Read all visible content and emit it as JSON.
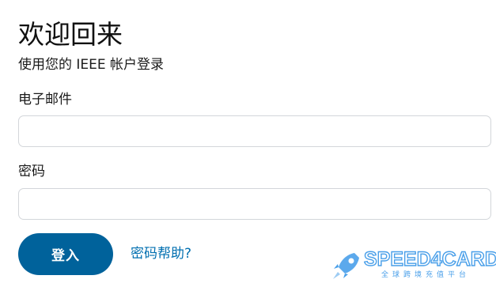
{
  "header": {
    "title": "欢迎回来",
    "subtitle": "使用您的 IEEE 帐户登录"
  },
  "form": {
    "email_label": "电子邮件",
    "email_value": "",
    "email_placeholder": "",
    "password_label": "密码",
    "password_value": "",
    "password_placeholder": "",
    "login_button": "登入",
    "help_link": "密码帮助?"
  },
  "watermark": {
    "brand": "SPEED4CARD",
    "tagline": "全球跨境充值平台",
    "icon": "rocket-icon",
    "color": "#2a8fe6"
  },
  "colors": {
    "primary": "#00629b",
    "link": "#006fb0",
    "input_border": "#d3d6da"
  }
}
